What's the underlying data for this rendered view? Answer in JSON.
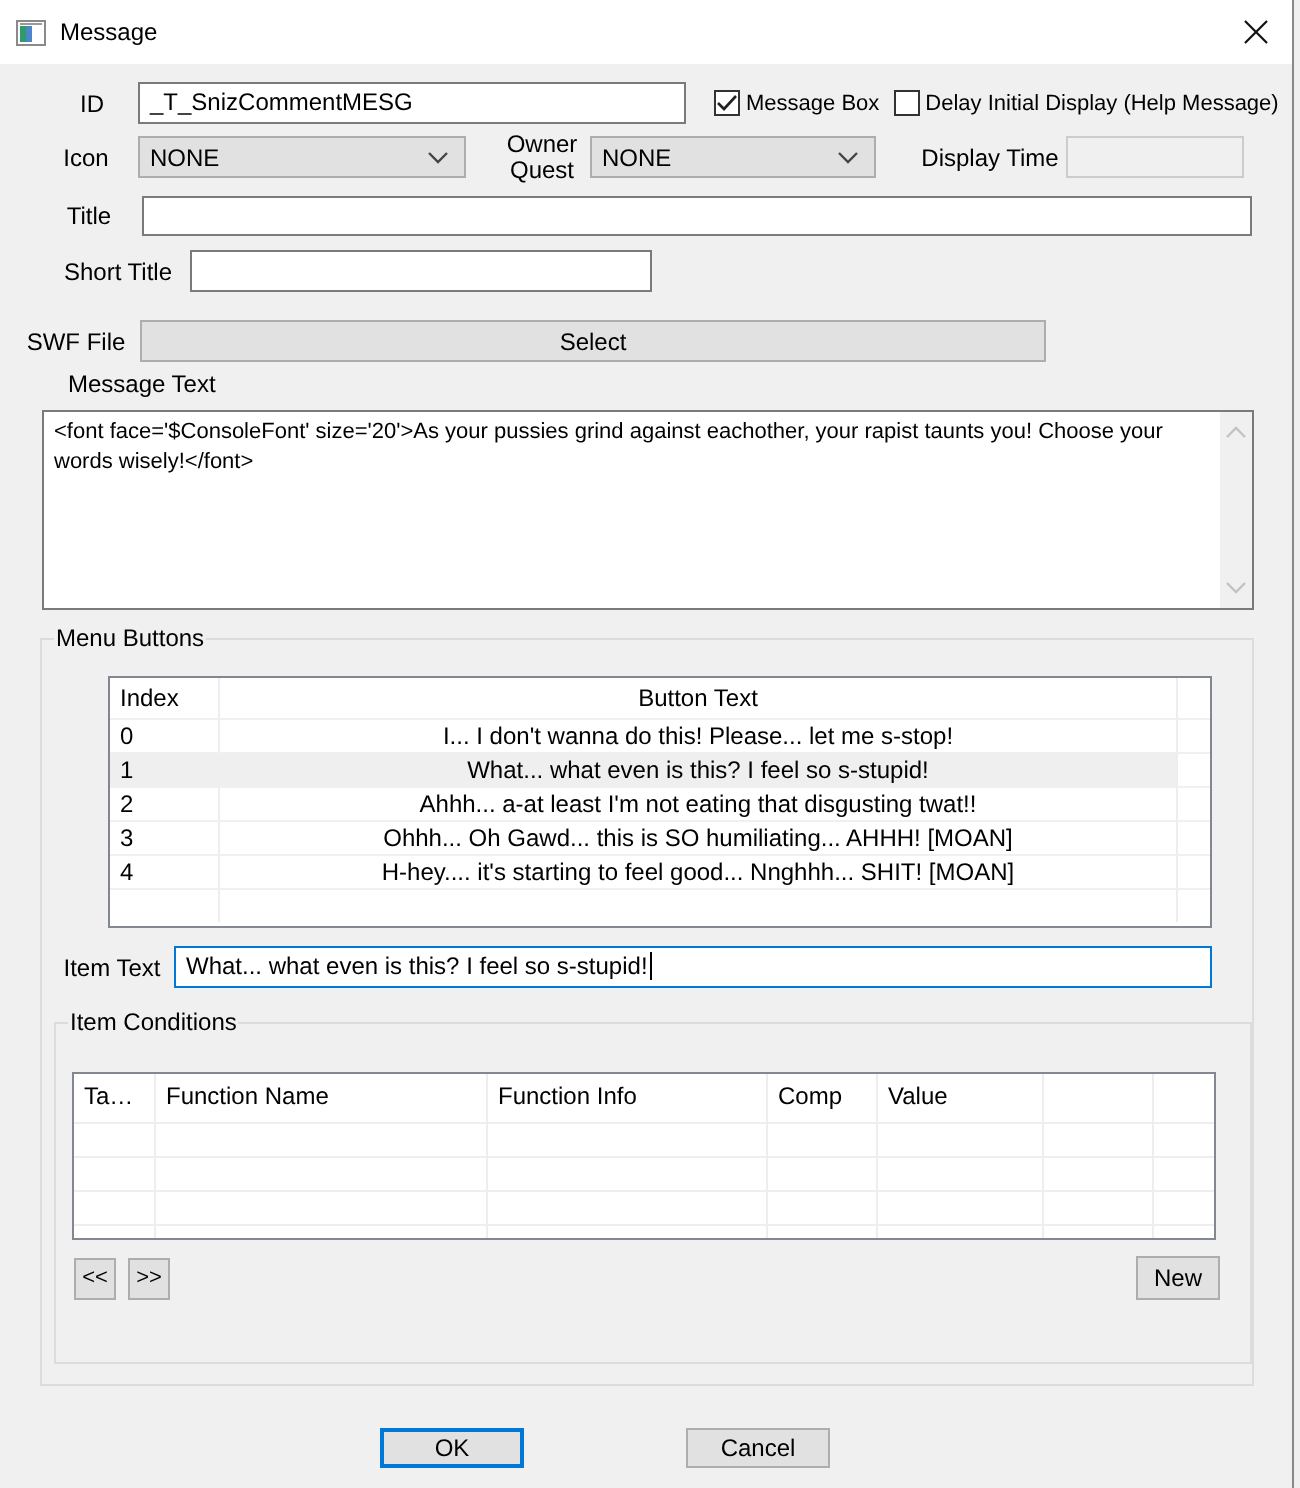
{
  "window": {
    "title": "Message"
  },
  "id_field": {
    "label": "ID",
    "value": "_T_SnizCommentMESG"
  },
  "message_box": {
    "label": "Message Box",
    "checked": true
  },
  "delay_initial_display": {
    "label": "Delay Initial Display (Help Message)",
    "checked": false
  },
  "icon": {
    "label": "Icon",
    "value": "NONE"
  },
  "owner_quest": {
    "label": "Owner Quest",
    "value": "NONE"
  },
  "display_time": {
    "label": "Display Time",
    "disabled": true
  },
  "title": {
    "label": "Title"
  },
  "short_title": {
    "label": "Short Title"
  },
  "swf_file": {
    "label": "SWF File",
    "button": "Select"
  },
  "message_text": {
    "label": "Message Text",
    "value": "<font face='$ConsoleFont' size='20'>As your pussies grind against eachother, your rapist taunts you! Choose your words wisely!</font>"
  },
  "menu_buttons": {
    "title": "Menu Buttons",
    "columns": [
      "Index",
      "Button Text"
    ],
    "rows": [
      {
        "index": "0",
        "text": "I... I don't wanna do this! Please... let me s-stop!",
        "selected": false
      },
      {
        "index": "1",
        "text": "What... what even is this? I feel so s-stupid!",
        "selected": true
      },
      {
        "index": "2",
        "text": "Ahhh... a-at least I'm not eating that disgusting twat!!",
        "selected": false
      },
      {
        "index": "3",
        "text": "Ohhh... Oh Gawd... this is SO humiliating... AHHH! [MOAN]",
        "selected": false
      },
      {
        "index": "4",
        "text": "H-hey.... it's starting to feel good... Nnghhh... SHIT! [MOAN]",
        "selected": false
      }
    ],
    "item_text": {
      "label": "Item Text",
      "value": "What... what even is this? I feel so s-stupid!",
      "focused": true
    }
  },
  "item_conditions": {
    "title": "Item Conditions",
    "columns": [
      "Ta…",
      "Function Name",
      "Function Info",
      "Comp",
      "Value"
    ],
    "buttons": [
      "<<",
      ">>",
      "New"
    ]
  },
  "buttons": [
    {
      "label": "OK",
      "default": true
    },
    {
      "label": "Cancel",
      "default": false
    }
  ]
}
